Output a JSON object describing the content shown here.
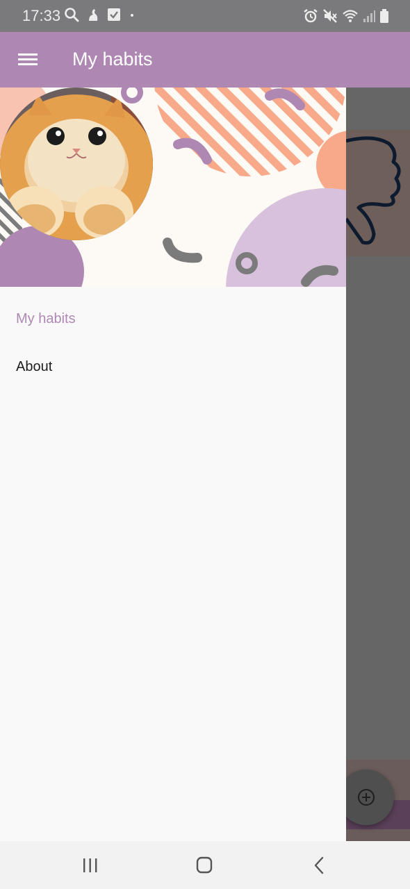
{
  "status_bar": {
    "time": "17:33",
    "left_icons": [
      "search-icon",
      "notification-icon",
      "checkbox-icon",
      "dot-icon"
    ],
    "right_icons": [
      "alarm-icon",
      "mute-icon",
      "wifi-icon",
      "signal-icon",
      "battery-icon"
    ]
  },
  "app_bar": {
    "title": "My habits",
    "menu_icon": "hamburger-menu-icon"
  },
  "drawer": {
    "items": [
      {
        "label": "My habits",
        "selected": true
      },
      {
        "label": "About",
        "selected": false
      }
    ]
  },
  "colors": {
    "accent": "#ae88b3",
    "status_bar": "#7a797b",
    "scrim": "#666666",
    "coral": "#f8a98a"
  },
  "fab": {
    "icon": "add-circle-icon"
  },
  "nav_bar": {
    "icons": [
      "recents-icon",
      "home-icon",
      "back-icon"
    ]
  }
}
